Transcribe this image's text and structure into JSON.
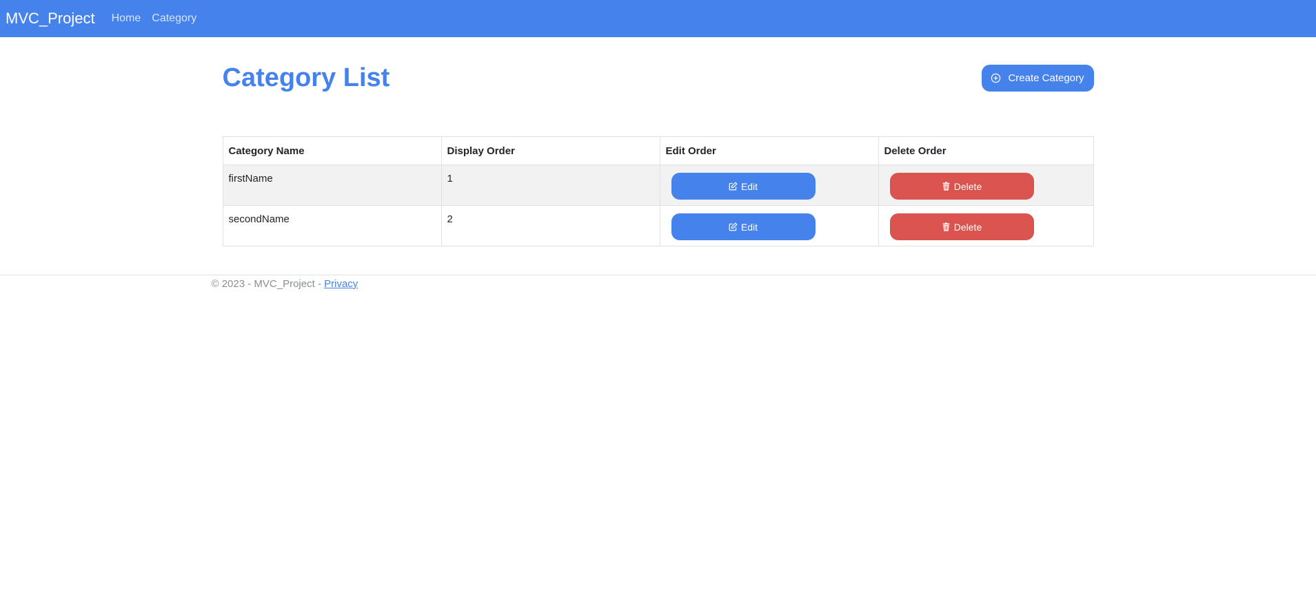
{
  "navbar": {
    "brand": "MVC_Project",
    "links": [
      "Home",
      "Category"
    ]
  },
  "page": {
    "title": "Category List",
    "create_label": "Create Category"
  },
  "table": {
    "headers": [
      "Category Name",
      "Display Order",
      "Edit Order",
      "Delete Order"
    ],
    "rows": [
      {
        "name": "firstName",
        "order": "1",
        "edit_label": "Edit",
        "delete_label": "Delete"
      },
      {
        "name": "secondName",
        "order": "2",
        "edit_label": "Edit",
        "delete_label": "Delete"
      }
    ]
  },
  "footer": {
    "text": "© 2023 - MVC_Project - ",
    "privacy_label": "Privacy"
  },
  "colors": {
    "primary": "#4582ec",
    "danger": "#d9534f",
    "row_stripe": "#f2f2f2"
  },
  "icons": {
    "create": "plus-circle-icon",
    "edit": "edit-icon",
    "delete": "trash-icon"
  }
}
